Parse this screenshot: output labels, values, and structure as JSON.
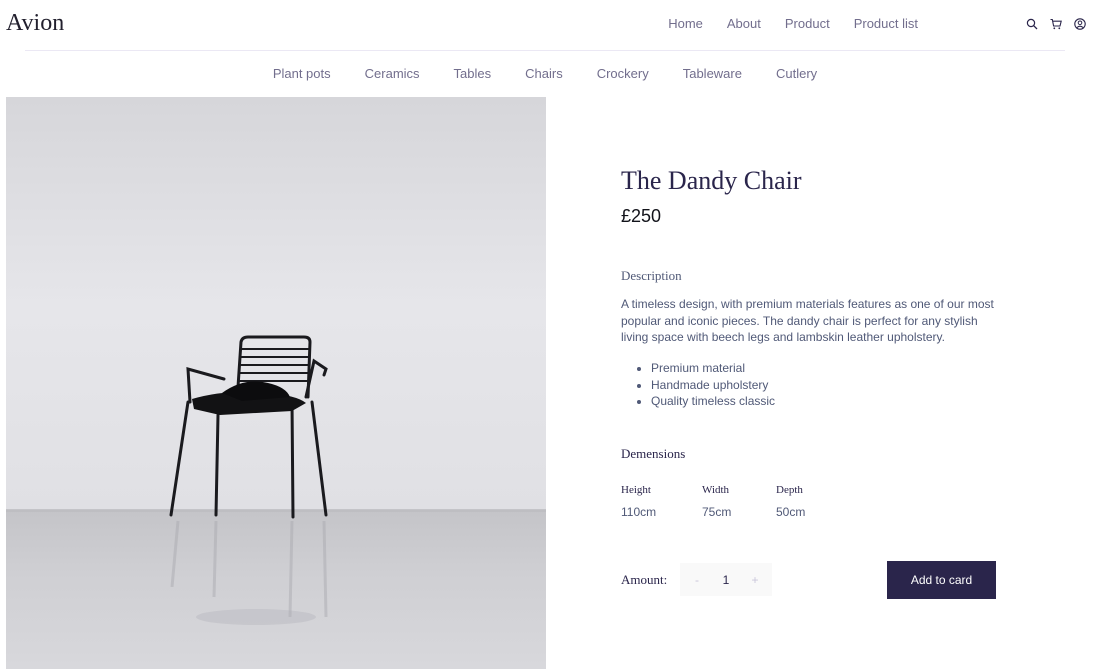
{
  "brand": {
    "logo": "Avion"
  },
  "nav": {
    "items": [
      "Home",
      "About",
      "Product",
      "Product list"
    ]
  },
  "header_icons": [
    "search-icon",
    "cart-icon",
    "user-icon"
  ],
  "categories": [
    "Plant pots",
    "Ceramics",
    "Tables",
    "Chairs",
    "Crockery",
    "Tableware",
    "Cutlery"
  ],
  "product": {
    "title": "The Dandy Chair",
    "price": "£250",
    "description_heading": "Description",
    "description": "A timeless design, with premium materials features as one of our most popular and iconic pieces. The dandy chair is perfect for any stylish living space with beech legs and lambskin leather upholstery.",
    "features": [
      "Premium material",
      "Handmade upholstery",
      "Quality timeless classic"
    ],
    "dimensions_heading": "Demensions",
    "dimensions": [
      {
        "label": "Height",
        "value": "110cm"
      },
      {
        "label": "Width",
        "value": "75cm"
      },
      {
        "label": "Depth",
        "value": "50cm"
      }
    ],
    "amount_label": "Amount:",
    "quantity": "1",
    "decrement": "-",
    "increment": "+",
    "add_button": "Add to card"
  },
  "colors": {
    "accent": "#2a254b",
    "muted": "#726e8d"
  }
}
